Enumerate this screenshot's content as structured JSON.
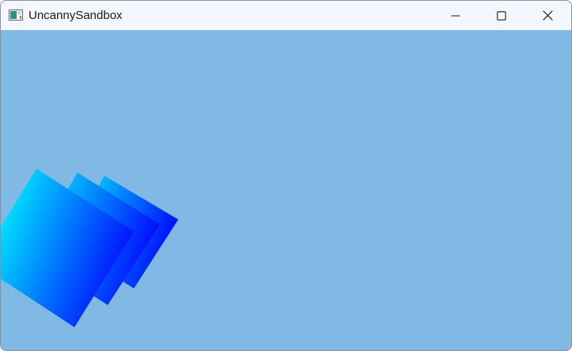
{
  "window": {
    "title": "UncannySandbox",
    "background_color": "#7fb9e4",
    "titlebar_color": "#f3f6fc"
  },
  "titlebar": {
    "app_icon": "app-window-icon",
    "buttons": [
      {
        "name": "minimize",
        "icon": "minimize-icon"
      },
      {
        "name": "maximize",
        "icon": "maximize-icon"
      },
      {
        "name": "close",
        "icon": "close-icon"
      }
    ]
  },
  "scene": {
    "object_count": 3,
    "gradient_start_color": "#00ffff",
    "gradient_end_color": "#0010ff"
  }
}
